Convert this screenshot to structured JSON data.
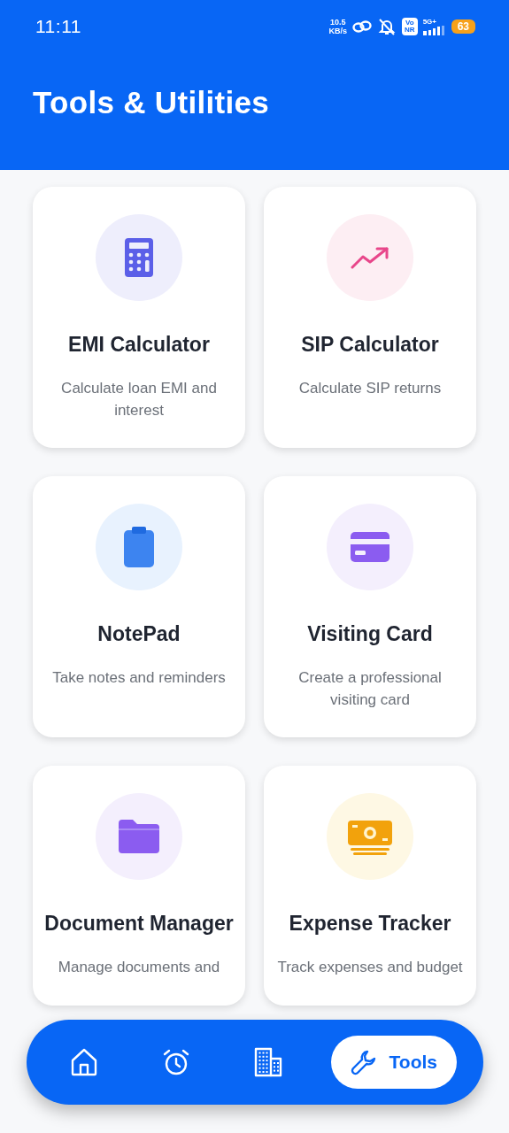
{
  "status_bar": {
    "time": "11:11",
    "speed_value": "10.5",
    "speed_unit": "KB/s",
    "volte": [
      "Vo",
      "NR"
    ],
    "network": "5G+",
    "battery": "63"
  },
  "header": {
    "title": "Tools & Utilities"
  },
  "tools": [
    {
      "title": "EMI Calculator",
      "description": "Calculate loan EMI and interest"
    },
    {
      "title": "SIP Calculator",
      "description": "Calculate SIP returns"
    },
    {
      "title": "NotePad",
      "description": "Take notes and reminders"
    },
    {
      "title": "Visiting Card",
      "description": "Create a professional visiting card"
    },
    {
      "title": "Document Manager",
      "description": "Manage documents and"
    },
    {
      "title": "Expense Tracker",
      "description": "Track expenses and budget"
    }
  ],
  "nav": {
    "items": [
      {
        "selected": false
      },
      {
        "selected": false
      },
      {
        "selected": false
      },
      {
        "label": "Tools",
        "selected": true
      }
    ]
  }
}
